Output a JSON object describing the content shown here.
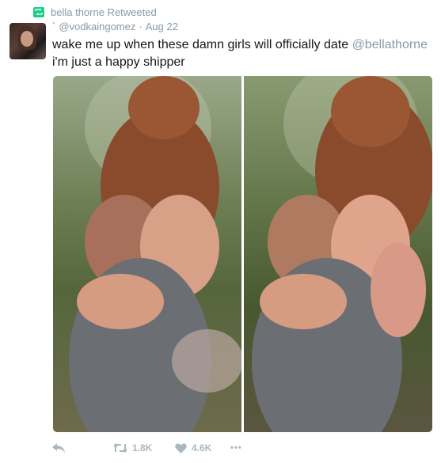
{
  "retweet_header": {
    "label": "bella thorne Retweeted"
  },
  "tweet": {
    "handle": "@vodkaingomez",
    "separator": "·",
    "date": "Aug 22",
    "text_before": "wake me up when these damn girls will officially date ",
    "mention": "@bellathorne",
    "text_after": " i'm just a happy shipper"
  },
  "actions": {
    "retweet_count": "1.8K",
    "like_count": "4.6K",
    "more_label": "•••"
  },
  "colors": {
    "retweet_green": "#19cf86",
    "muted": "#8899a6",
    "text": "#14171a",
    "action_gray": "#aab8c2"
  },
  "icons": [
    "retweet-badge-icon",
    "reply-icon",
    "retweet-icon",
    "heart-icon",
    "more-icon"
  ]
}
